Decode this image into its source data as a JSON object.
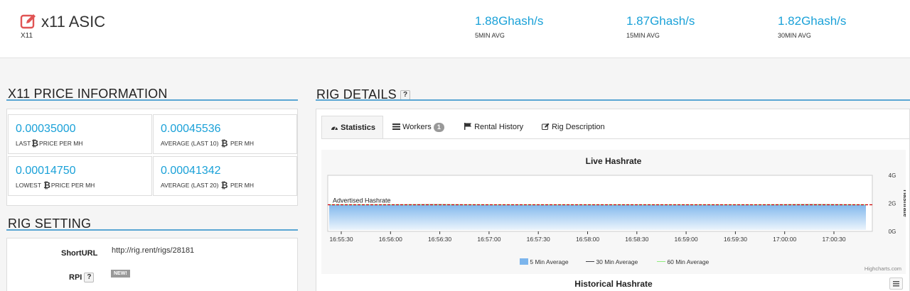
{
  "header": {
    "title": "x11 ASIC",
    "algo": "X11",
    "hashrates": [
      {
        "value": "1.88Ghash/s",
        "label": "5MIN AVG"
      },
      {
        "value": "1.87Ghash/s",
        "label": "15MIN AVG"
      },
      {
        "value": "1.82Ghash/s",
        "label": "30MIN AVG"
      }
    ]
  },
  "price": {
    "title": "X11 PRICE INFORMATION",
    "boxes": [
      {
        "value": "0.00035000",
        "pre": "LAST",
        "post": "PRICE PER MH"
      },
      {
        "value": "0.00045536",
        "pre": "AVERAGE (LAST 10)",
        "post": "PER MH"
      },
      {
        "value": "0.00014750",
        "pre": "LOWEST",
        "post": "PRICE PER MH"
      },
      {
        "value": "0.00041342",
        "pre": "AVERAGE (LAST 20)",
        "post": "PER MH"
      }
    ]
  },
  "settings": {
    "title": "RIG SETTING",
    "shorturl_label": "ShortURL",
    "shorturl_value": "http://rig.rent/rigs/28181",
    "rpi_label": "RPI",
    "new_badge": "NEW!"
  },
  "details": {
    "title": "RIG DETAILS",
    "help": "?",
    "tabs": [
      {
        "label": "Statistics",
        "icon": "dashboard-icon"
      },
      {
        "label": "Workers",
        "icon": "list-icon",
        "count": "1"
      },
      {
        "label": "Rental History",
        "icon": "flag-icon"
      },
      {
        "label": "Rig Description",
        "icon": "edit-icon"
      }
    ],
    "historical_title": "Historical Hashrate",
    "credit": "Highcharts.com"
  },
  "chart_data": {
    "type": "area",
    "title": "Live Hashrate",
    "xlabel": "",
    "ylabel": "Hashrate",
    "x": [
      "16:55:30",
      "16:56:00",
      "16:56:30",
      "16:57:00",
      "16:57:30",
      "16:58:00",
      "16:58:30",
      "16:59:00",
      "16:59:30",
      "17:00:00",
      "17:00:30"
    ],
    "yticks": [
      "0G",
      "2G",
      "4G"
    ],
    "ylim": [
      0,
      4
    ],
    "plotline": {
      "label": "Advertised Hashrate",
      "value": 1.9,
      "color": "#cc0000"
    },
    "series": [
      {
        "name": "5 Min Average",
        "color": "#7cb5ec",
        "values": [
          1.88,
          1.88,
          1.89,
          1.88,
          1.88,
          1.88,
          1.88,
          1.88,
          1.88,
          1.89,
          1.88
        ]
      },
      {
        "name": "30 Min Average",
        "color": "#434348",
        "values": [
          1.9,
          1.9,
          1.91,
          1.9,
          1.9,
          1.9,
          1.9,
          1.9,
          1.9,
          1.91,
          1.9
        ]
      },
      {
        "name": "60 Min Average",
        "color": "#90ed7d",
        "values": [
          1.9,
          1.9,
          1.9,
          1.9,
          1.9,
          1.9,
          1.9,
          1.9,
          1.9,
          1.9,
          1.9
        ]
      }
    ],
    "grid": false,
    "legend": "bottom"
  }
}
